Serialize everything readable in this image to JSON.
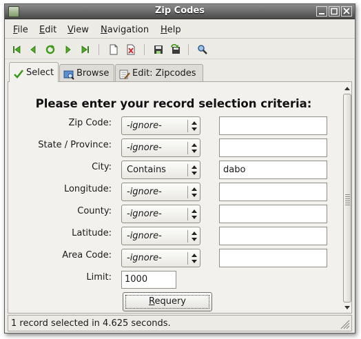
{
  "window": {
    "title": "Zip Codes"
  },
  "menu": [
    {
      "mnemonic": "F",
      "rest": "ile"
    },
    {
      "mnemonic": "E",
      "rest": "dit"
    },
    {
      "mnemonic": "V",
      "rest": "iew"
    },
    {
      "mnemonic": "N",
      "rest": "avigation"
    },
    {
      "mnemonic": "H",
      "rest": "elp"
    }
  ],
  "toolbar": {
    "icons": [
      "first-record-icon",
      "prior-record-icon",
      "requery-icon",
      "next-record-icon",
      "last-record-icon",
      "new-record-icon",
      "delete-record-icon",
      "save-icon",
      "cancel-icon",
      "sql-icon"
    ]
  },
  "tabs": [
    {
      "label": "Select",
      "icon": "checkmark-icon",
      "active": true
    },
    {
      "label": "Browse",
      "icon": "browse-icon",
      "active": false
    },
    {
      "label": "Edit: Zipcodes",
      "icon": "edit-icon",
      "active": false
    }
  ],
  "form": {
    "heading": "Please enter your record selection criteria:",
    "rows": [
      {
        "label": "Zip Code:",
        "operator": "-ignore-",
        "value": ""
      },
      {
        "label": "State / Province:",
        "operator": "-ignore-",
        "value": ""
      },
      {
        "label": "City:",
        "operator": "Contains",
        "value": "dabo"
      },
      {
        "label": "Longitude:",
        "operator": "-ignore-",
        "value": ""
      },
      {
        "label": "County:",
        "operator": "-ignore-",
        "value": ""
      },
      {
        "label": "Latitude:",
        "operator": "-ignore-",
        "value": ""
      },
      {
        "label": "Area Code:",
        "operator": "-ignore-",
        "value": ""
      }
    ],
    "limit": {
      "label": "Limit:",
      "value": "1000"
    },
    "requery": {
      "mnemonic": "R",
      "rest": "equery"
    }
  },
  "status": {
    "text": "1 record selected in 4.625 seconds."
  }
}
